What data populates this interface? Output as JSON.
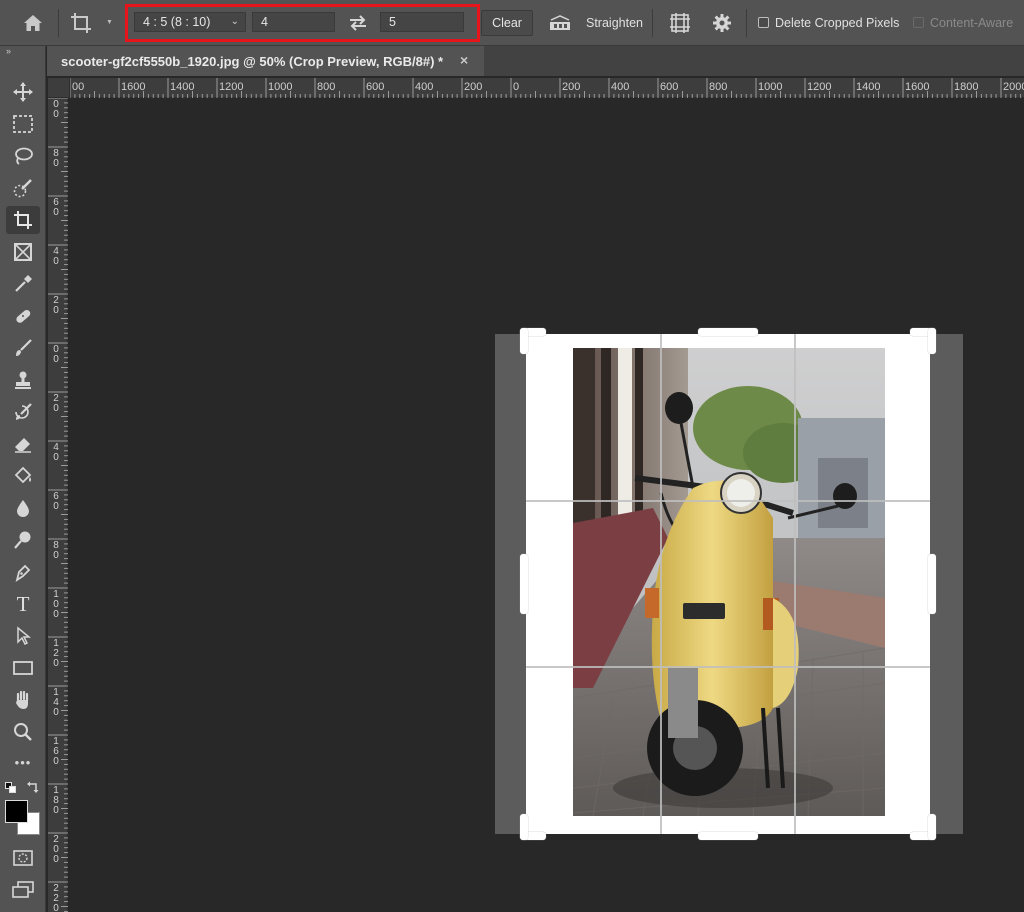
{
  "options_bar": {
    "home_icon": "home-icon",
    "crop_preset_icon": "crop-icon",
    "ratio_select": "4 : 5 (8 : 10)",
    "width_value": "4",
    "height_value": "5",
    "swap_icon": "swap-arrows-icon",
    "clear_label": "Clear",
    "straighten_icon": "straighten-level-icon",
    "straighten_label": "Straighten",
    "overlay_icon": "grid-overlay-icon",
    "settings_icon": "gear-icon",
    "delete_cropped_label": "Delete Cropped Pixels",
    "delete_cropped_checked": false,
    "content_aware_label": "Content-Aware",
    "content_aware_checked": false,
    "highlight_color": "#e8141b"
  },
  "tab": {
    "title": "scooter-gf2cf5550b_1920.jpg @ 50% (Crop Preview, RGB/8#) *",
    "close_glyph": "×"
  },
  "toolbar": {
    "collapse_glyph": "»",
    "tools": [
      "move-tool",
      "rectangular-marquee-tool",
      "lasso-tool",
      "quick-selection-tool",
      "crop-tool",
      "frame-tool",
      "eyedropper-tool",
      "spot-healing-brush-tool",
      "brush-tool",
      "clone-stamp-tool",
      "history-brush-tool",
      "eraser-tool",
      "paint-bucket-tool",
      "blur-tool",
      "dodge-tool",
      "pen-tool",
      "type-tool",
      "path-selection-tool",
      "rectangle-tool",
      "hand-tool",
      "zoom-tool",
      "edit-toolbar",
      "default-colors",
      "swap-colors",
      "foreground-color",
      "background-color",
      "quick-mask-mode",
      "screen-mode"
    ],
    "active_tool": "crop-tool",
    "type_glyph": "T",
    "more_glyph": "•••",
    "foreground_color": "#000000",
    "background_color": "#ffffff"
  },
  "ruler": {
    "horizontal_labels": [
      "00",
      "1600",
      "1400",
      "1200",
      "1000",
      "800",
      "600",
      "400",
      "200",
      "0",
      "200",
      "400",
      "600",
      "800",
      "1000",
      "1200",
      "1400",
      "1600",
      "1800",
      "2000"
    ],
    "vertical_labels": [
      "0",
      "8",
      "6",
      "4",
      "2",
      "0",
      "2",
      "4",
      "6",
      "8",
      "10",
      "12",
      "14",
      "16",
      "18",
      "20",
      "22"
    ]
  },
  "canvas": {
    "background": "#282828",
    "outside_crop_shade": "#5c5c5c",
    "crop_fill": "#ffffff",
    "thirds_grid": true
  }
}
